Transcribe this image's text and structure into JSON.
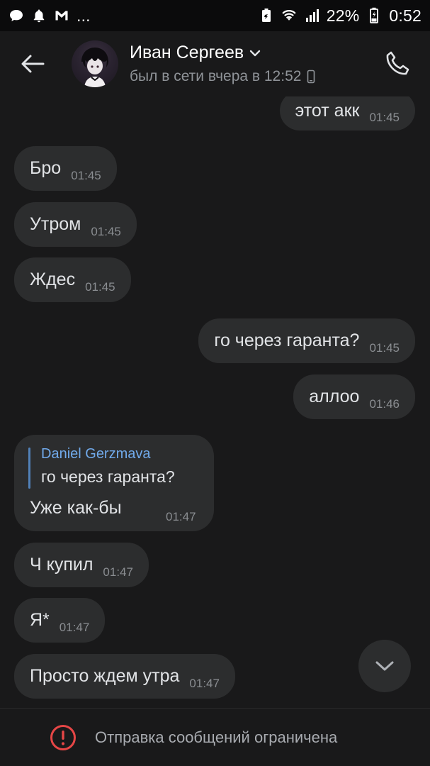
{
  "status_bar": {
    "notifications": [
      "chat-bubble-icon",
      "bell-icon",
      "gmail-icon",
      "more-icon"
    ],
    "more": "...",
    "battery_percent": "22%",
    "time": "0:52"
  },
  "header": {
    "contact_name": "Иван Сергеев",
    "status": "был в сети вчера в 12:52"
  },
  "messages": [
    {
      "dir": "out",
      "text": "этот акк",
      "time": "01:45"
    },
    {
      "dir": "in",
      "text": "Бро",
      "time": "01:45"
    },
    {
      "dir": "in",
      "text": "Утром",
      "time": "01:45"
    },
    {
      "dir": "in",
      "text": "Ждес",
      "time": "01:45"
    },
    {
      "dir": "out",
      "text": "го через гаранта?",
      "time": "01:45"
    },
    {
      "dir": "out",
      "text": "аллоо",
      "time": "01:46"
    },
    {
      "dir": "in",
      "reply": {
        "author": "Daniel Gerzmava",
        "quote": "го через гаранта?"
      },
      "text": "Уже как-бы",
      "time": "01:47"
    },
    {
      "dir": "in",
      "text": "Ч купил",
      "time": "01:47"
    },
    {
      "dir": "in",
      "text": "Я*",
      "time": "01:47"
    },
    {
      "dir": "in",
      "text": "Просто ждем утра",
      "time": "01:47"
    }
  ],
  "footer": {
    "restricted_text": "Отправка сообщений ограничена"
  },
  "colors": {
    "background": "#19191a",
    "bubble": "#2c2d2e",
    "accent": "#71aaeb",
    "warning": "#e64646"
  }
}
